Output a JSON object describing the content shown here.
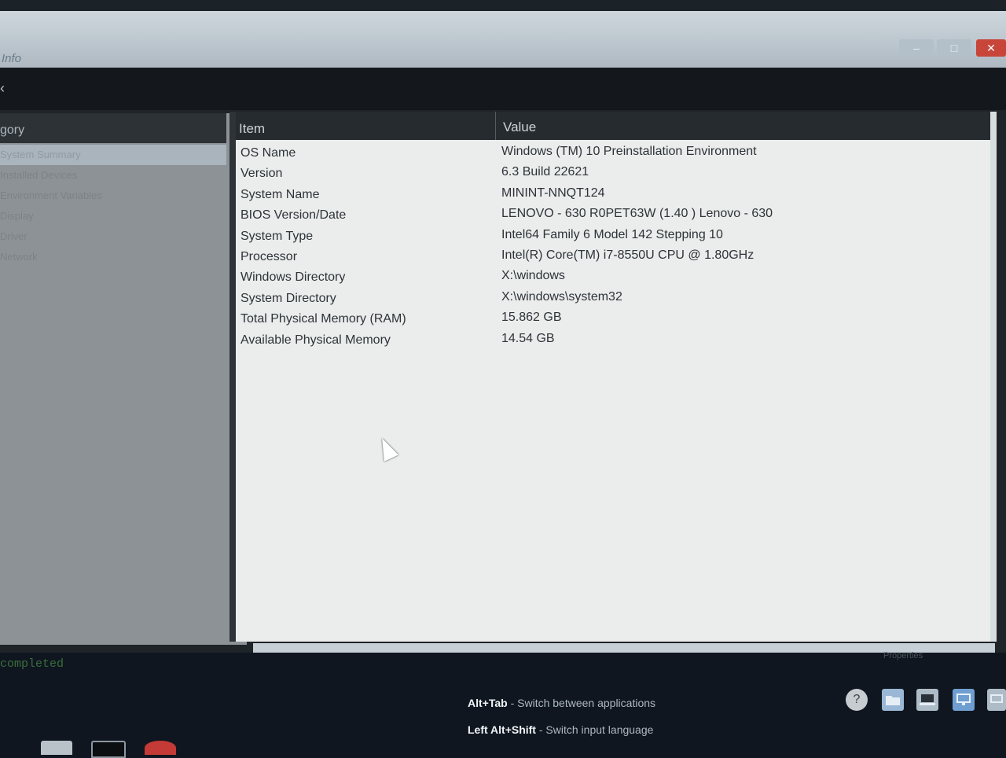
{
  "window": {
    "title": "Info",
    "controls": {
      "minimize": "–",
      "maximize": "□",
      "close": "✕"
    }
  },
  "toolbar": {
    "back_glyph": "‹"
  },
  "sidebar": {
    "header": "gory",
    "items": [
      {
        "label": "System Summary",
        "selected": true
      },
      {
        "label": "Installed Devices",
        "selected": false
      },
      {
        "label": "Environment Variables",
        "selected": false
      },
      {
        "label": "Display",
        "selected": false
      },
      {
        "label": "Driver",
        "selected": false
      },
      {
        "label": "Network",
        "selected": false
      }
    ]
  },
  "table": {
    "columns": {
      "item": "Item",
      "value": "Value"
    },
    "rows": [
      {
        "item": "OS Name",
        "value": "Windows (TM) 10 Preinstallation Environment"
      },
      {
        "item": "Version",
        "value": "6.3 Build 22621"
      },
      {
        "item": "System Name",
        "value": "MININT-NNQT124"
      },
      {
        "item": "BIOS Version/Date",
        "value": "LENOVO - 630 R0PET63W (1.40 ) Lenovo - 630"
      },
      {
        "item": "System Type",
        "value": "Intel64 Family 6 Model 142 Stepping 10"
      },
      {
        "item": "Processor",
        "value": "Intel(R) Core(TM) i7-8550U CPU @ 1.80GHz"
      },
      {
        "item": "Windows Directory",
        "value": "X:\\windows"
      },
      {
        "item": "System Directory",
        "value": "X:\\windows\\system32"
      },
      {
        "item": "Total Physical Memory (RAM)",
        "value": "15.862 GB"
      },
      {
        "item": "Available Physical Memory",
        "value": "14.54 GB"
      }
    ]
  },
  "console": {
    "text": "completed"
  },
  "status": {
    "properties": "Properties"
  },
  "hints": [
    {
      "keys": "Alt+Tab",
      "desc": "- Switch between applications"
    },
    {
      "keys": "Left Alt+Shift",
      "desc": "- Switch input language"
    }
  ],
  "tray": {
    "help_glyph": "?",
    "icons": [
      "help-icon",
      "folder-icon",
      "computer-icon",
      "network-icon",
      "display-icon"
    ]
  },
  "colors": {
    "title_bar": "#bcc6ce",
    "close_button": "#c8453a",
    "panel_background": "#eaedec",
    "header_dark": "#262b30"
  }
}
